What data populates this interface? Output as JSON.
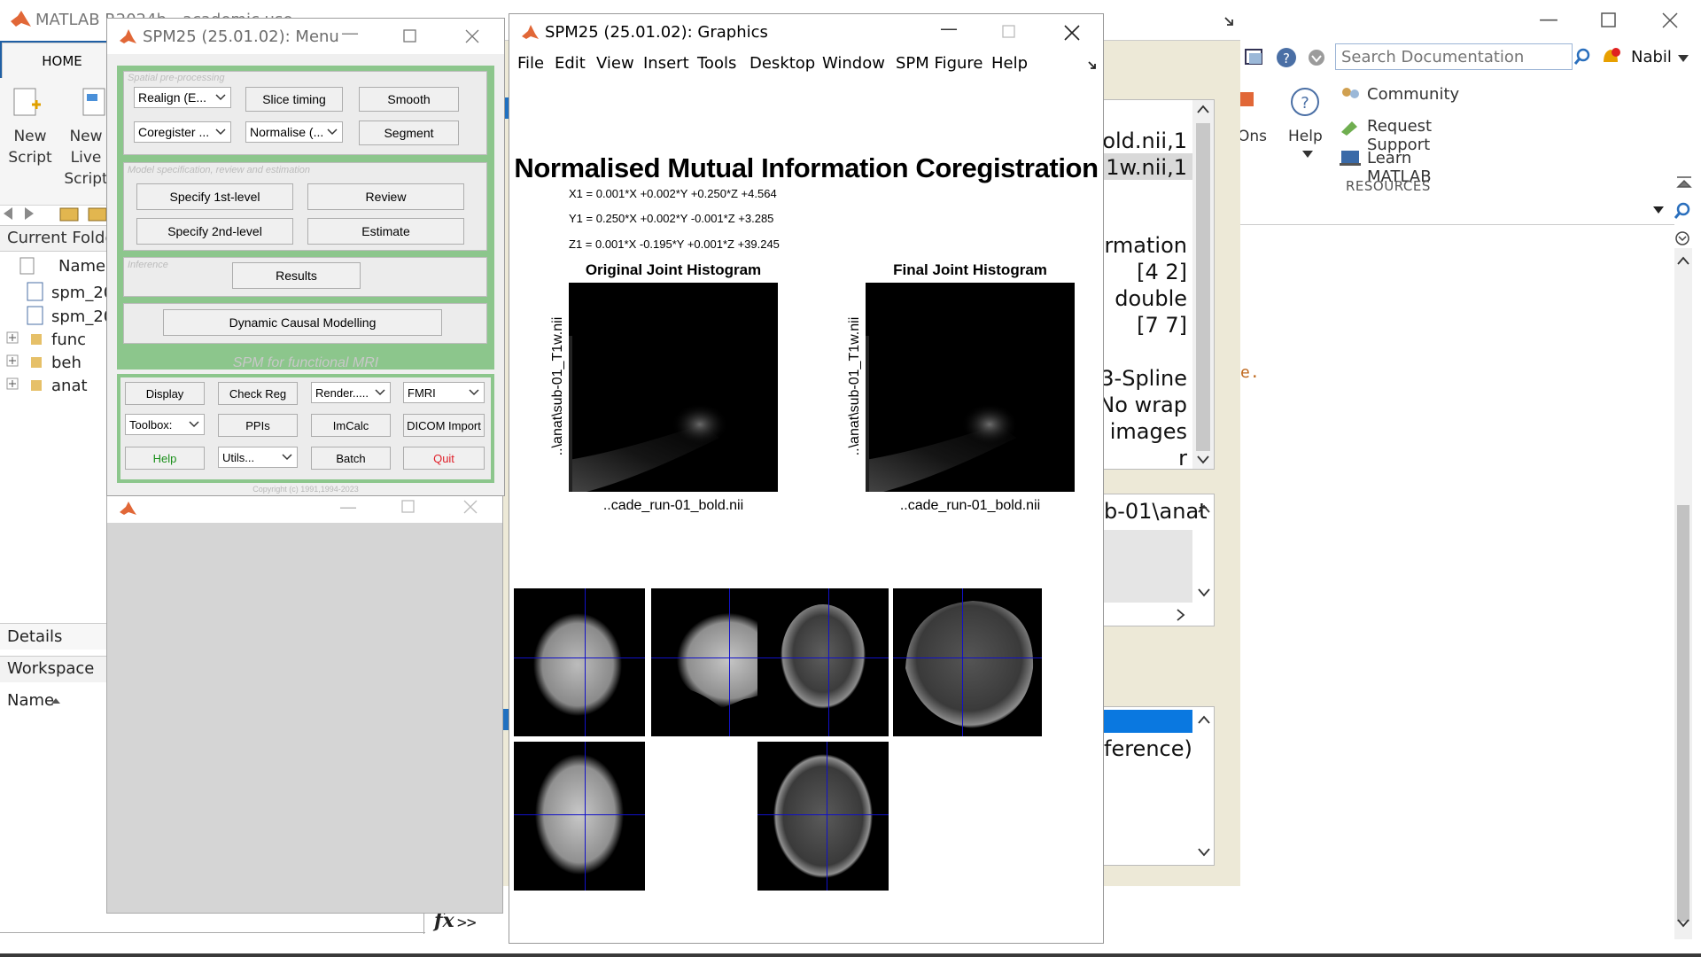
{
  "matlab": {
    "title": "MATLAB R2024b - academic use",
    "home_tab": "HOME",
    "new_script": "New Script",
    "new_live_script": "New Live Script",
    "addons_label": "Ons",
    "help_label": "Help",
    "resources": {
      "community": "Community",
      "request_support": "Request Support",
      "learn_matlab": "Learn MATLAB",
      "heading": "RESOURCES"
    },
    "search_placeholder": "Search Documentation",
    "user": "Nabil",
    "current_folder": {
      "title": "Current Folder",
      "col_name": "Name",
      "items": [
        "spm_20",
        "spm_20",
        "func",
        "beh",
        "anat"
      ]
    },
    "details_label": "Details",
    "workspace_label": "Workspace",
    "workspace_col": "Name",
    "command_prompt": ">>",
    "fx": "fx",
    "editor_snippet": "e."
  },
  "behind_panel": {
    "lines_top": [
      "old.nii,1",
      "1w.nii,1"
    ],
    "lines_mid": [
      "rmation",
      "[4 2]",
      "double",
      "[7 7]",
      "3-Spline",
      "No wrap",
      "images",
      "r"
    ],
    "path_text": "b-01\\anat",
    "bottom_text": "ference)"
  },
  "spm_menu": {
    "title": "SPM25 (25.01.02): Menu",
    "spatial_label": "Spatial pre-processing",
    "realign": "Realign (E...",
    "slice_timing": "Slice timing",
    "smooth": "Smooth",
    "coregister": "Coregister ...",
    "normalise": "Normalise (...",
    "segment": "Segment",
    "model_label": "Model specification, review and estimation",
    "specify_first": "Specify 1st-level",
    "review": "Review",
    "specify_second": "Specify 2nd-level",
    "estimate": "Estimate",
    "inference_label": "Inference",
    "results": "Results",
    "dcm": "Dynamic Causal Modelling",
    "fmri_caption": "SPM for functional MRI",
    "display": "Display",
    "check_reg": "Check Reg",
    "render": "Render.....",
    "modality": "FMRI",
    "toolbox": "Toolbox:",
    "ppis": "PPIs",
    "imcalc": "ImCalc",
    "dicom_import": "DICOM Import",
    "help": "Help",
    "utils": "Utils...",
    "batch": "Batch",
    "quit": "Quit",
    "copyright": "Copyright (c) 1991,1994-2023",
    "help_color": "#1a8f1a",
    "quit_color": "#e0202a"
  },
  "spm_graphics": {
    "title": "SPM25 (25.01.02): Graphics",
    "menus": [
      "File",
      "Edit",
      "View",
      "Insert",
      "Tools",
      "Desktop",
      "Window",
      "SPM Figure",
      "Help"
    ],
    "plot_title": "Normalised Mutual Information Coregistration",
    "equations": [
      "X1 = 0.001*X +0.002*Y +0.250*Z +4.564",
      "Y1 = 0.250*X +0.002*Y -0.001*Z +3.285",
      "Z1 = 0.001*X -0.195*Y +0.001*Z +39.245"
    ],
    "hist_left_title": "Original Joint Histogram",
    "hist_right_title": "Final Joint Histogram",
    "y_label": "..\\anat\\sub-01_T1w.nii",
    "x_label": "..cade_run-01_bold.nii",
    "crosshair_color": "#1111c8"
  }
}
